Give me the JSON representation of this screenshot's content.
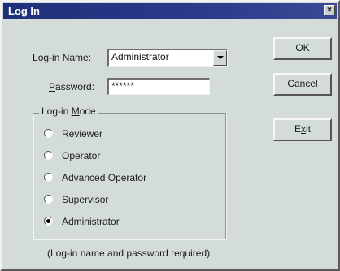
{
  "window": {
    "title": "Log In",
    "close_glyph": "×"
  },
  "form": {
    "login_name_prefix": "L",
    "login_name_accel": "o",
    "login_name_rest": "g-in Name:",
    "login_name_value": "Administrator",
    "password_accel": "P",
    "password_rest": "assword:",
    "password_value": "******"
  },
  "buttons": {
    "ok": "OK",
    "cancel": "Cancel",
    "exit_prefix": "E",
    "exit_accel": "x",
    "exit_rest": "it"
  },
  "mode": {
    "group_label_prefix": "Log-in ",
    "group_label_accel": "M",
    "group_label_rest": "ode",
    "options": [
      {
        "label": "Reviewer",
        "selected": false
      },
      {
        "label": "Operator",
        "selected": false
      },
      {
        "label": "Advanced Operator",
        "selected": false
      },
      {
        "label": "Supervisor",
        "selected": false
      },
      {
        "label": "Administrator",
        "selected": true
      }
    ]
  },
  "footer": {
    "note": "(Log-in name and password required)"
  },
  "icons": {
    "dropdown": "chevron-down-icon",
    "close": "close-icon"
  }
}
